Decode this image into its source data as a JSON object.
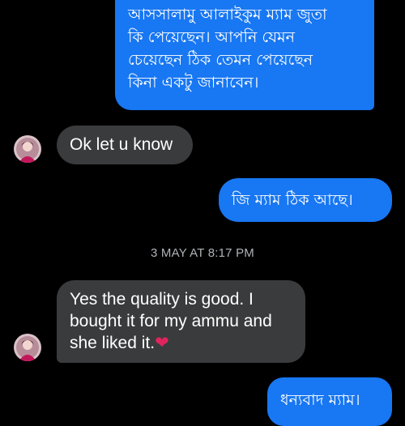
{
  "messages": [
    {
      "direction": "outgoing",
      "lines": [
        "আসসালামু আলাইকুম ম্যাম জুতা",
        "কি পেয়েছেন।  আপনি যেমন",
        "চেয়েছেন ঠিক তেমন পেয়েছেন",
        "কিনা একটু জানাবেন।"
      ]
    },
    {
      "direction": "incoming",
      "text": "Ok let u know"
    },
    {
      "direction": "outgoing",
      "text": "জি ম্যাম ঠিক আছে।"
    },
    {
      "direction": "incoming",
      "lines": [
        "Yes the quality is good. I",
        "bought it for my ammu and",
        "she liked it."
      ],
      "emoji": "❤"
    },
    {
      "direction": "outgoing",
      "text": "ধন্যবাদ ম্যাম।"
    }
  ],
  "timestamp": "3 MAY AT 8:17 PM",
  "colors": {
    "outgoing_bubble": "#1877f2",
    "incoming_bubble": "#3a3b3c",
    "background": "#000000",
    "timestamp": "#b0b3b8",
    "heart": "#e0245e"
  },
  "icons": {
    "avatar": "user-avatar-icon",
    "heart": "red-heart-emoji"
  }
}
